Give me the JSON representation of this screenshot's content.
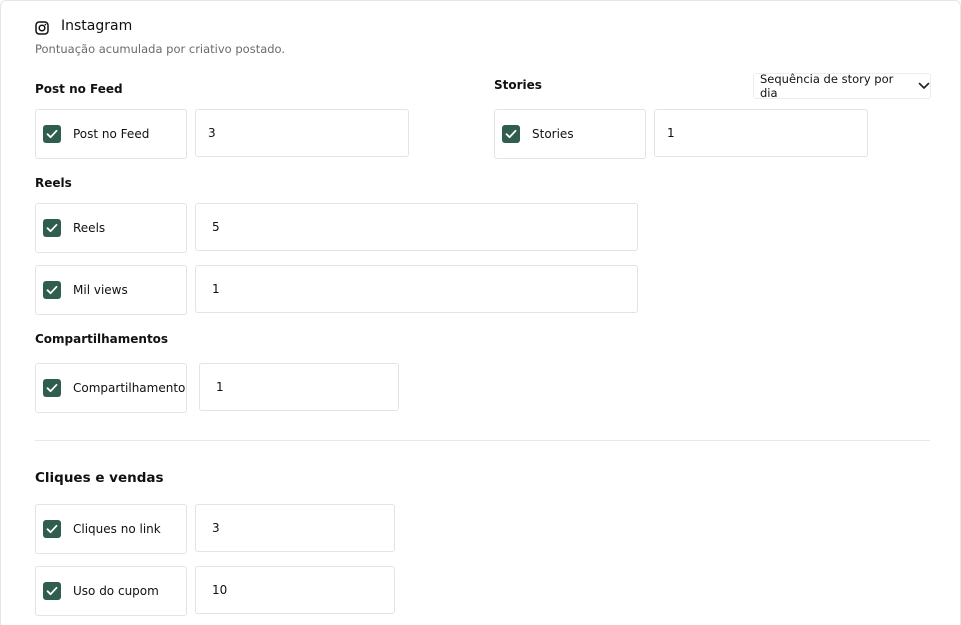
{
  "header": {
    "title": "Instagram",
    "subtitle": "Pontuação acumulada por criativo postado."
  },
  "post_feed": {
    "section_label": "Post no Feed",
    "checkbox_label": "Post no Feed",
    "checked": true,
    "value": "3"
  },
  "stories": {
    "section_label": "Stories",
    "select_value": "Sequência de story por dia",
    "checkbox_label": "Stories",
    "checked": true,
    "value": "1"
  },
  "reels": {
    "section_label": "Reels",
    "items": [
      {
        "checkbox_label": "Reels",
        "checked": true,
        "value": "5"
      },
      {
        "checkbox_label": "Mil views",
        "checked": true,
        "value": "1"
      }
    ]
  },
  "shares": {
    "section_label": "Compartilhamentos",
    "checkbox_label": "Compartilhamento",
    "checked": true,
    "value": "1"
  },
  "clicks_sales": {
    "section_label": "Cliques e vendas",
    "items": [
      {
        "checkbox_label": "Cliques no link",
        "checked": true,
        "value": "3"
      },
      {
        "checkbox_label": "Uso do cupom",
        "checked": true,
        "value": "10"
      }
    ]
  },
  "colors": {
    "checkbox_fill": "#2f5e4e",
    "border": "#e3e3e3",
    "muted_text": "#6b6b6b"
  },
  "icons": {
    "platform": "instagram-icon",
    "checkbox": "check-icon",
    "dropdown": "chevron-down-icon"
  }
}
